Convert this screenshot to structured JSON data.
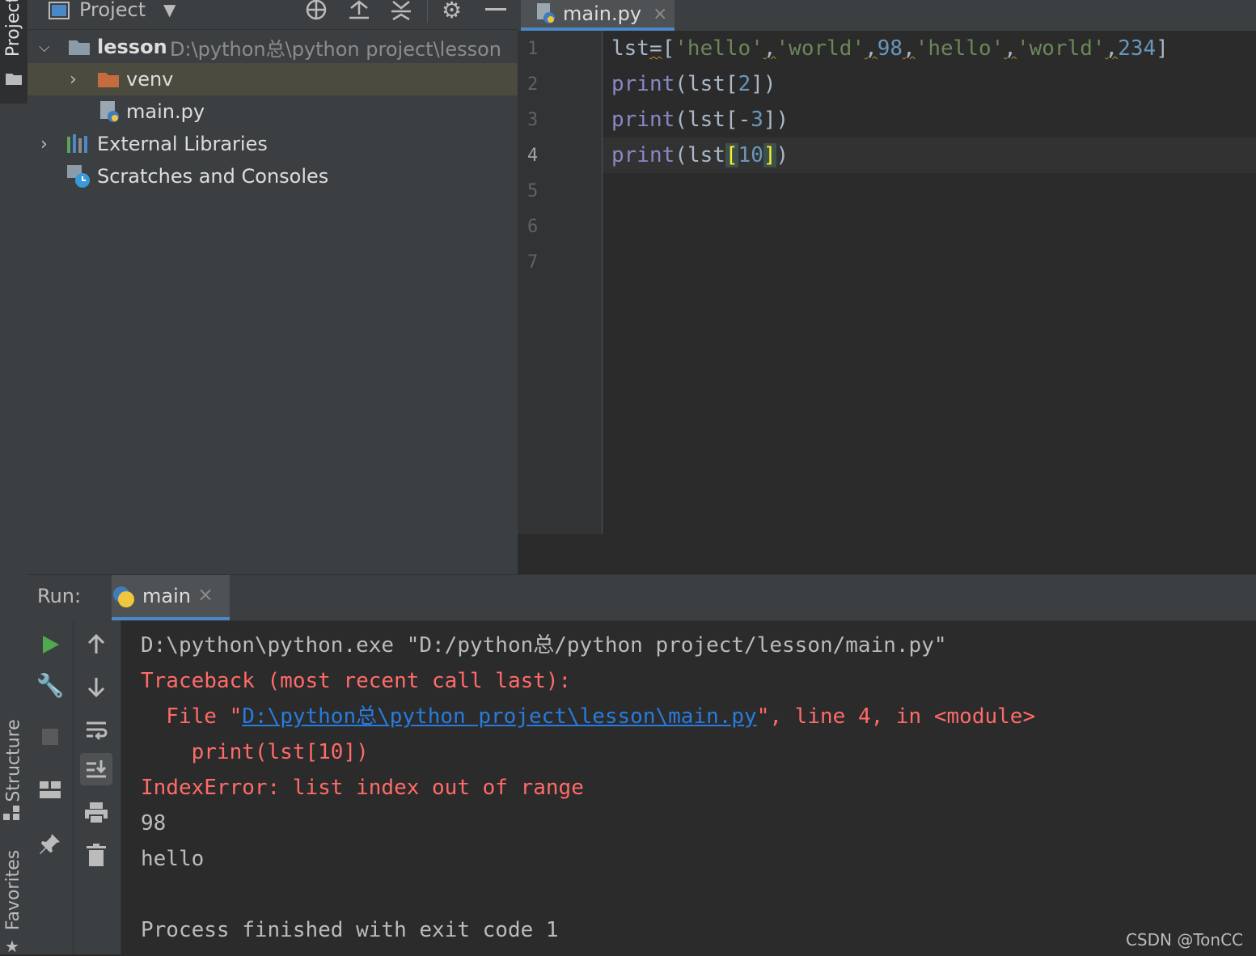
{
  "colors": {
    "background": "#2b2b2b",
    "panel": "#3c3f41",
    "keyword": "#8888c6",
    "string": "#6a8759",
    "number": "#6897bb",
    "error": "#ff6b68",
    "link": "#287bde",
    "selection": "#4b4b3f"
  },
  "sidebar": {
    "project_tab": "Project",
    "structure_tab": "Structure",
    "favorites_tab": "Favorites"
  },
  "project": {
    "title": "Project",
    "tree": {
      "root_name": "lesson",
      "root_path": "D:\\python总\\python project\\lesson",
      "venv": "venv",
      "main_file": "main.py",
      "external_libraries": "External Libraries",
      "scratches": "Scratches and Consoles"
    }
  },
  "editor": {
    "tab_label": "main.py",
    "line_numbers": [
      "1",
      "2",
      "3",
      "4",
      "5",
      "6",
      "7"
    ],
    "lines": [
      "lst=['hello','world',98,'hello','world',234]",
      "print(lst[2])",
      "print(lst[-3])",
      "print(lst[10])"
    ]
  },
  "run": {
    "label": "Run:",
    "tab_label": "main",
    "console": {
      "command": "D:\\python\\python.exe \"D:/python总/python project/lesson/main.py\"",
      "traceback": "Traceback (most recent call last):",
      "file_prefix": "  File \"",
      "file_link": "D:\\python总\\python project\\lesson\\main.py",
      "file_suffix": "\", line 4, in <module>",
      "code_line": "    print(lst[10])",
      "error": "IndexError: list index out of range",
      "out_1": "98",
      "out_2": "hello",
      "exit": "Process finished with exit code 1"
    }
  },
  "watermark": "CSDN @TonCC"
}
